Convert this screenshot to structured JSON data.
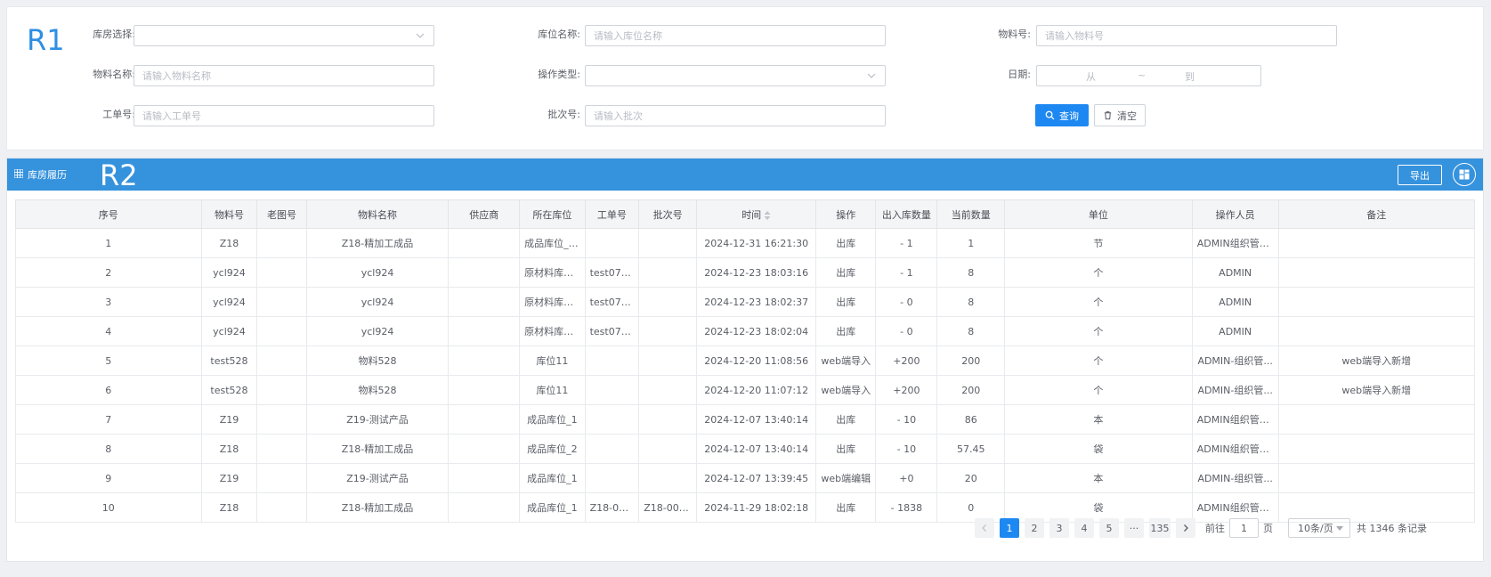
{
  "annotations": {
    "r1": "R1",
    "r2": "R2"
  },
  "filters": {
    "warehouse_label": "库房选择:",
    "location_label": "库位名称:",
    "location_placeholder": "请输入库位名称",
    "material_no_label": "物料号:",
    "material_no_placeholder": "请输入物料号",
    "material_name_label": "物料名称:",
    "material_name_placeholder": "请输入物料名称",
    "op_type_label": "操作类型:",
    "date_label": "日期:",
    "date_from": "从",
    "date_sep": "~",
    "date_to": "到",
    "work_order_label": "工单号:",
    "work_order_placeholder": "请输入工单号",
    "batch_label": "批次号:",
    "batch_placeholder": "请输入批次",
    "query_button": "查询",
    "clear_button": "清空"
  },
  "history": {
    "title": "库房履历",
    "export_button": "导出",
    "columns": [
      "序号",
      "物料号",
      "老图号",
      "物料名称",
      "供应商",
      "所在库位",
      "工单号",
      "批次号",
      "时间",
      "操作",
      "出入库数量",
      "当前数量",
      "单位",
      "操作人员",
      "备注"
    ],
    "rows": [
      [
        "1",
        "Z18",
        "",
        "Z18-精加工成品",
        "",
        "成品库位_11",
        "",
        "",
        "2024-12-31 16:21:30",
        "出库",
        "- 1",
        "1",
        "节",
        "ADMIN组织管理...",
        ""
      ],
      [
        "2",
        "ycl924",
        "",
        "ycl924",
        "",
        "原材料库位...",
        "test0788...",
        "",
        "2024-12-23 18:03:16",
        "出库",
        "- 1",
        "8",
        "个",
        "ADMIN",
        ""
      ],
      [
        "3",
        "ycl924",
        "",
        "ycl924",
        "",
        "原材料库位...",
        "test0788...",
        "",
        "2024-12-23 18:02:37",
        "出库",
        "- 0",
        "8",
        "个",
        "ADMIN",
        ""
      ],
      [
        "4",
        "ycl924",
        "",
        "ycl924",
        "",
        "原材料库位...",
        "test0788...",
        "",
        "2024-12-23 18:02:04",
        "出库",
        "- 0",
        "8",
        "个",
        "ADMIN",
        ""
      ],
      [
        "5",
        "test528",
        "",
        "物料528",
        "",
        "库位11",
        "",
        "",
        "2024-12-20 11:08:56",
        "web端导入",
        "+200",
        "200",
        "个",
        "ADMIN-组织管...",
        "web端导入新增"
      ],
      [
        "6",
        "test528",
        "",
        "物料528",
        "",
        "库位11",
        "",
        "",
        "2024-12-20 11:07:12",
        "web端导入",
        "+200",
        "200",
        "个",
        "ADMIN-组织管...",
        "web端导入新增"
      ],
      [
        "7",
        "Z19",
        "",
        "Z19-测试产品",
        "",
        "成品库位_1",
        "",
        "",
        "2024-12-07 13:40:14",
        "出库",
        "- 10",
        "86",
        "本",
        "ADMIN组织管理...",
        ""
      ],
      [
        "8",
        "Z18",
        "",
        "Z18-精加工成品",
        "",
        "成品库位_2",
        "",
        "",
        "2024-12-07 13:40:14",
        "出库",
        "- 10",
        "57.45",
        "袋",
        "ADMIN组织管理...",
        ""
      ],
      [
        "9",
        "Z19",
        "",
        "Z19-测试产品",
        "",
        "成品库位_1",
        "",
        "",
        "2024-12-07 13:39:45",
        "web端编辑",
        "+0",
        "20",
        "本",
        "ADMIN-组织管...",
        ""
      ],
      [
        "10",
        "Z18",
        "",
        "Z18-精加工成品",
        "",
        "成品库位_1",
        "Z18-000...",
        "Z18-000...",
        "2024-11-29 18:02:18",
        "出库",
        "- 1838",
        "0",
        "袋",
        "ADMIN组织管理...",
        ""
      ]
    ]
  },
  "pagination": {
    "pages": [
      "1",
      "2",
      "3",
      "4",
      "5"
    ],
    "ellipsis": "···",
    "last_page": "135",
    "goto_label": "前往",
    "goto_value": "1",
    "page_unit": "页",
    "page_size": "10条/页",
    "total": "共 1346 条记录"
  },
  "colors": {
    "primary": "#1e88f2",
    "header_blue": "#3592dd",
    "negative": "#f0282d",
    "positive": "#43a81e"
  },
  "icons": [
    "chevron-down-icon",
    "search-icon",
    "trash-icon",
    "grid-icon",
    "layout-icon",
    "sort-icon",
    "chevron-left-icon",
    "chevron-right-icon"
  ]
}
